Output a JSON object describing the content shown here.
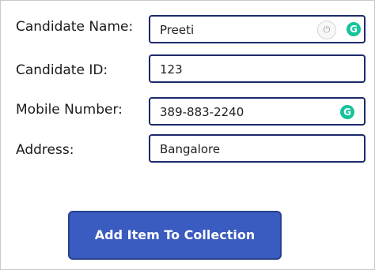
{
  "form": {
    "candidate_name": {
      "label": "Candidate Name:",
      "value": "Preeti"
    },
    "candidate_id": {
      "label": "Candidate ID:",
      "value": "123"
    },
    "mobile_number": {
      "label": "Mobile Number:",
      "value": "389-883-2240"
    },
    "address": {
      "label": "Address:",
      "value": "Bangalore"
    }
  },
  "icons": {
    "grammarly": "grammarly-icon",
    "power": "power-icon"
  },
  "colors": {
    "field_border": "#1c2a6b",
    "button_bg": "#3a5bbf",
    "grammarly_green": "#15c39a"
  },
  "actions": {
    "add_item_label": "Add Item To Collection"
  }
}
